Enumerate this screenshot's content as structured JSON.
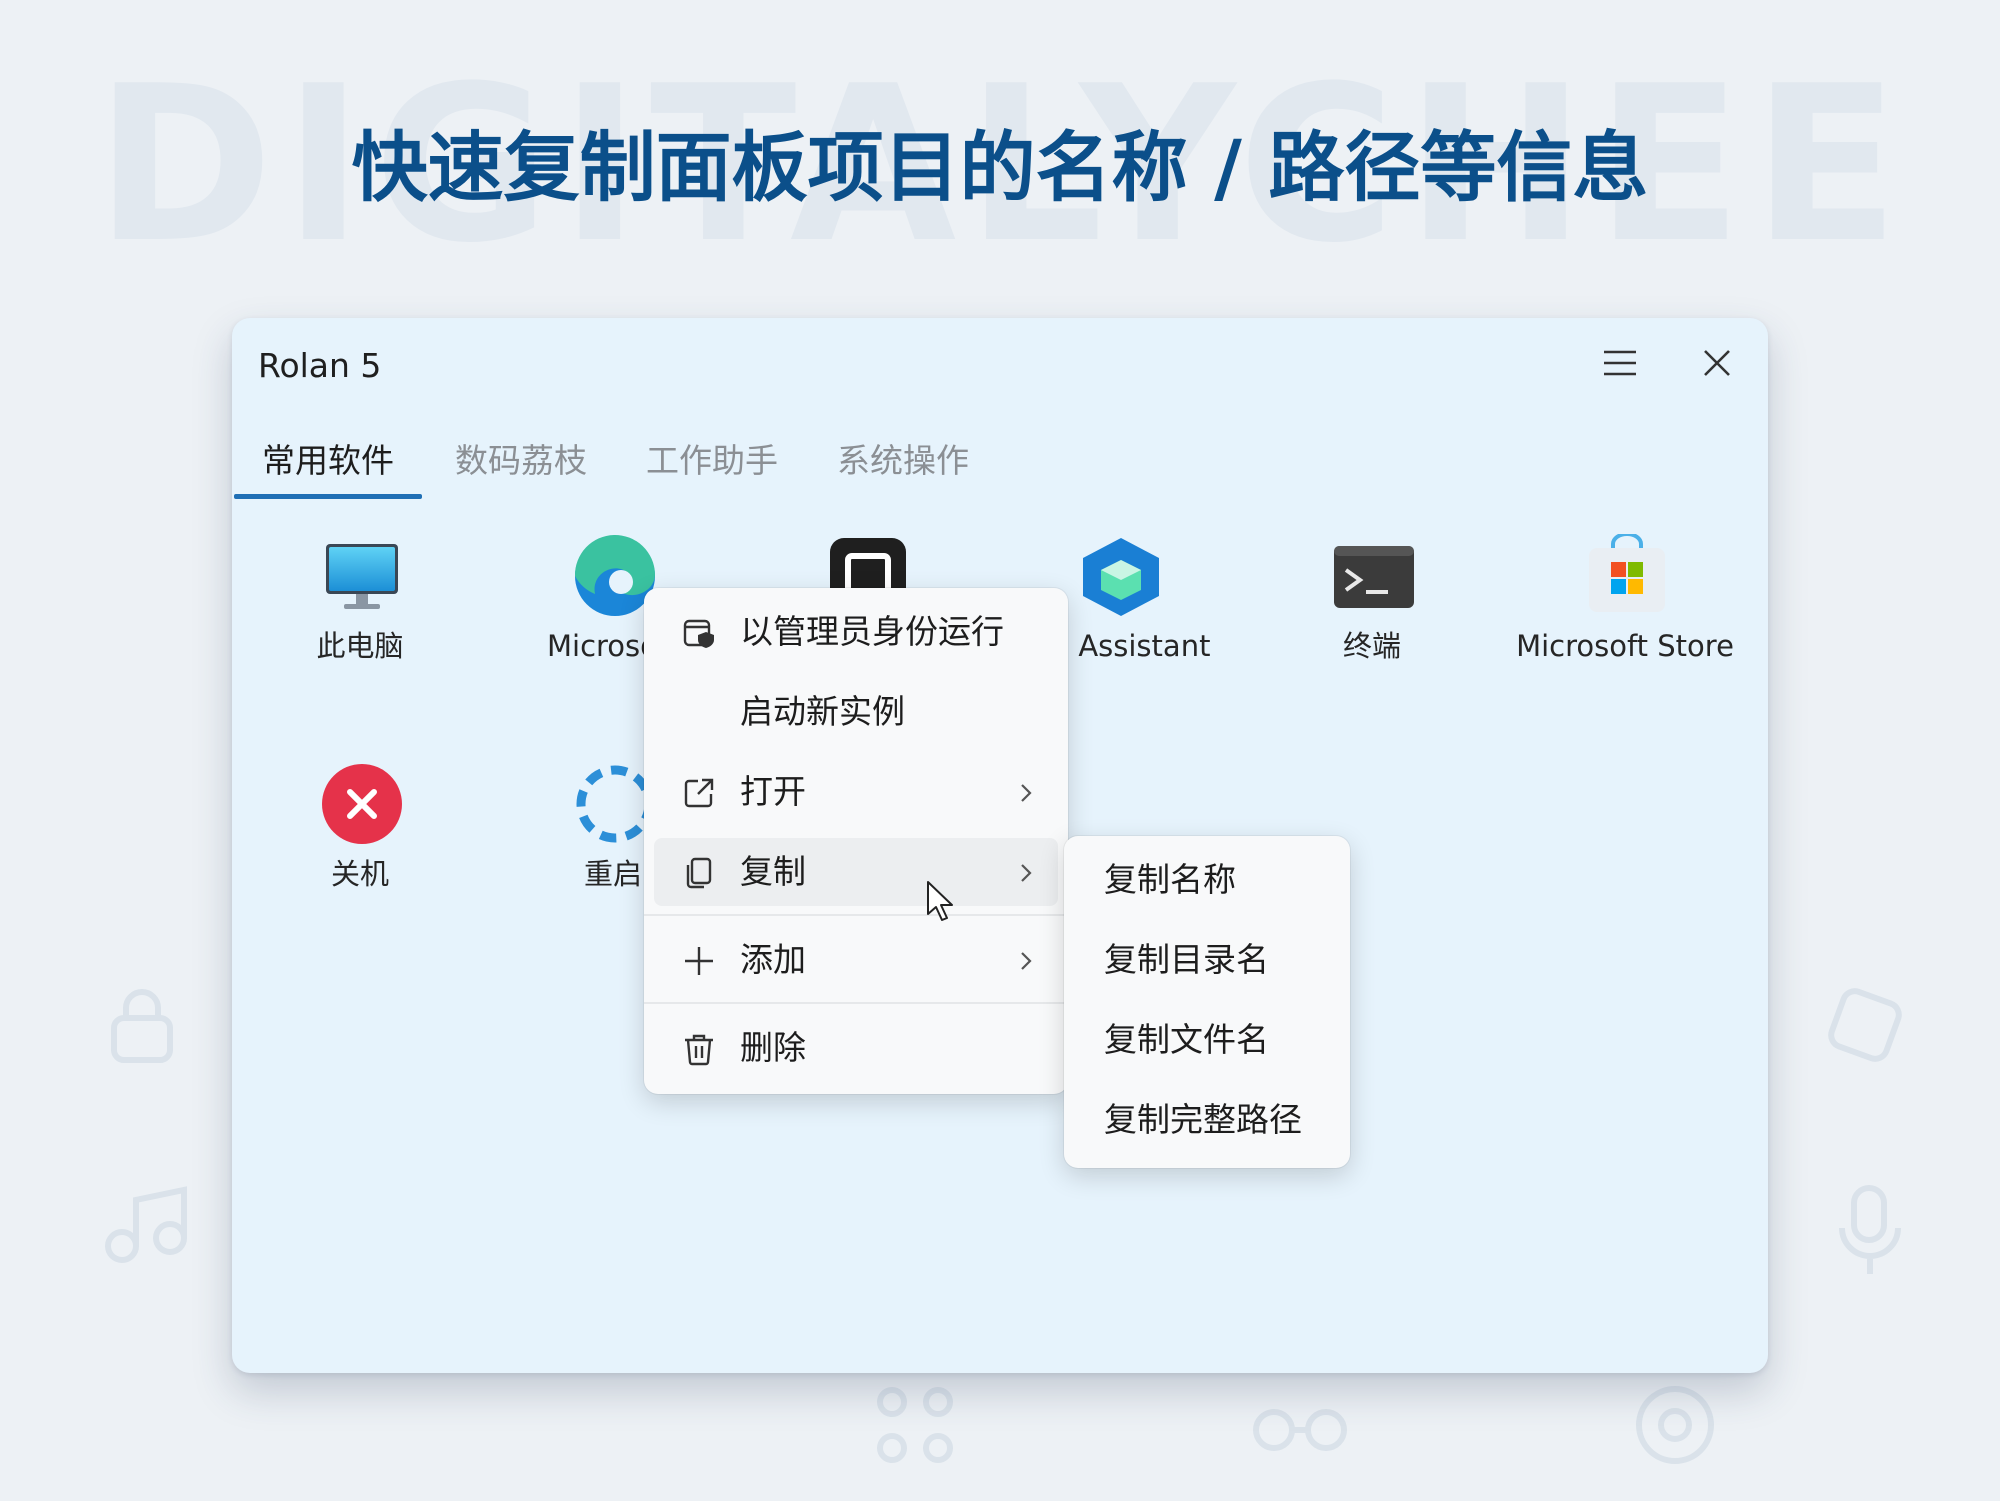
{
  "background": {
    "watermark": "DIGITALYCHEE",
    "headline": "快速复制面板项目的名称 / 路径等信息"
  },
  "colors": {
    "accent": "#1f6fb5",
    "headline": "#0b4f8a",
    "window_bg": "#e6f3fc"
  },
  "window": {
    "title": "Rolan 5",
    "menu_icon": "hamburger-icon",
    "close_icon": "close-icon"
  },
  "tabs": [
    {
      "label": "常用软件",
      "active": true
    },
    {
      "label": "数码荔枝",
      "active": false
    },
    {
      "label": "工作助手",
      "active": false
    },
    {
      "label": "系统操作",
      "active": false
    }
  ],
  "apps": [
    {
      "label": "此电脑",
      "icon": "monitor-icon"
    },
    {
      "label": "Microsoft",
      "icon": "edge-icon"
    },
    {
      "label": "",
      "icon": "app-square-icon"
    },
    {
      "label": "dis Assistant",
      "icon": "cube-icon"
    },
    {
      "label": "终端",
      "icon": "terminal-icon"
    },
    {
      "label": "Microsoft Store",
      "icon": "store-icon"
    },
    {
      "label": "关机",
      "icon": "shutdown-icon"
    },
    {
      "label": "重启",
      "icon": "restart-icon"
    }
  ],
  "context_menu": {
    "items": [
      {
        "label": "以管理员身份运行",
        "icon": "shield-window-icon"
      },
      {
        "label": "启动新实例",
        "icon": ""
      },
      {
        "label": "打开",
        "icon": "open-external-icon",
        "submenu": true
      },
      {
        "label": "复制",
        "icon": "copy-icon",
        "submenu": true,
        "hover": true
      },
      {
        "label": "添加",
        "icon": "plus-icon",
        "submenu": true
      },
      {
        "label": "删除",
        "icon": "trash-icon"
      }
    ]
  },
  "copy_submenu": {
    "items": [
      {
        "label": "复制名称"
      },
      {
        "label": "复制目录名"
      },
      {
        "label": "复制文件名"
      },
      {
        "label": "复制完整路径"
      }
    ]
  }
}
